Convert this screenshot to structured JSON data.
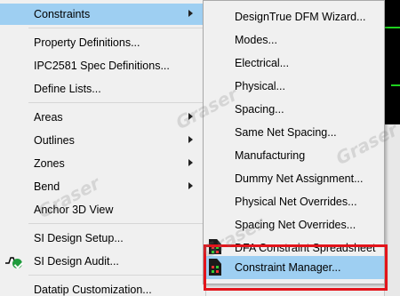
{
  "main_menu": {
    "items": [
      {
        "label": "Constraints",
        "has_submenu": true,
        "highlighted": true
      },
      {
        "label": "Property Definitions...",
        "has_submenu": false
      },
      {
        "label": "IPC2581 Spec Definitions...",
        "has_submenu": false
      },
      {
        "label": "Define Lists...",
        "has_submenu": false
      },
      {
        "label": "Areas",
        "has_submenu": true
      },
      {
        "label": "Outlines",
        "has_submenu": true
      },
      {
        "label": "Zones",
        "has_submenu": true
      },
      {
        "label": "Bend",
        "has_submenu": true
      },
      {
        "label": "Anchor 3D View",
        "has_submenu": false
      },
      {
        "label": "SI Design Setup...",
        "has_submenu": false
      },
      {
        "label": "SI Design Audit...",
        "has_submenu": false
      },
      {
        "label": "Datatip Customization...",
        "has_submenu": false
      }
    ]
  },
  "constraints_submenu": {
    "items": [
      {
        "label": "DesignTrue DFM Wizard..."
      },
      {
        "label": "Modes..."
      },
      {
        "label": "Electrical..."
      },
      {
        "label": "Physical..."
      },
      {
        "label": "Spacing..."
      },
      {
        "label": "Same Net Spacing..."
      },
      {
        "label": "Manufacturing"
      },
      {
        "label": "Dummy Net Assignment..."
      },
      {
        "label": "Physical Net Overrides..."
      },
      {
        "label": "Spacing Net Overrides..."
      },
      {
        "label": "DFA Constraint Spreadsheet",
        "icon": "spreadsheet-icon"
      },
      {
        "label": "Constraint Manager...",
        "icon": "spreadsheet-icon",
        "selected": true
      }
    ]
  },
  "watermark": "Graser",
  "colors": {
    "highlight": "#9ecff2",
    "annotation_box": "#e3141b",
    "check_green": "#1f9b3c"
  }
}
